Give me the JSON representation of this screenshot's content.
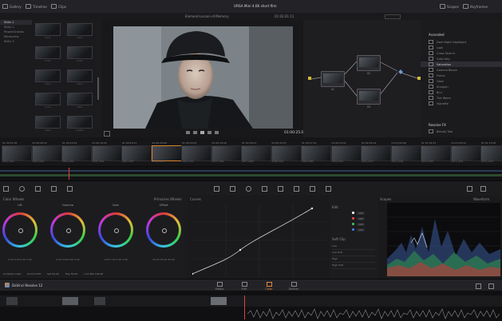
{
  "topbar": {
    "left_buttons": [
      "Gallery",
      "Timeline",
      "Clips"
    ],
    "title": "URSA Mini 4.6K short film",
    "right_buttons": [
      "Scopes",
      "Keyframes"
    ]
  },
  "viewer": {
    "clip_name": "Element-Lesson-of-Memory",
    "source_timecode": "01:02:41:11",
    "timecode": "01:00:25:09"
  },
  "gallery": {
    "albums": [
      "Stills 1",
      "Stills 2",
      "PowerGrades",
      "Memories",
      "Stills 3"
    ],
    "thumbs": [
      "1.1.1",
      "1.2.1",
      "1.3.1",
      "1.4.1",
      "1.5.1",
      "1.6.1",
      "1.7.1",
      "1.8.1",
      "1.9.1",
      "1.10.1",
      "1.11.1",
      "1.12.1",
      "1.13.1",
      "1.14.1"
    ]
  },
  "nodes": {
    "labels": [
      "01",
      "02",
      "03",
      "04"
    ]
  },
  "library": {
    "header": "Ascended",
    "items": [
      "Dark Night Hightlight",
      "Look",
      "Cross Fade In",
      "Color Key",
      "Saturation",
      "Gamma Bloom",
      "Flares",
      "Glow",
      "Sharpen",
      "Blur",
      "Tint Warm",
      "Vignette"
    ],
    "selected_index": 4,
    "footer": "Resolve FX",
    "footer_item": "Beauty Tool"
  },
  "strip": {
    "timecodes": [
      "01:00:03:18",
      "01:00:08:12",
      "01:00:12:04",
      "01:00:16:22",
      "01:00:20:11",
      "01:00:25:09",
      "01:00:30:02",
      "01:00:34:16",
      "01:00:38:21",
      "01:00:43:07",
      "01:00:47:14",
      "01:00:52:01",
      "01:00:56:19",
      "01:01:00:08",
      "01:01:04:23",
      "01:01:09:10",
      "01:01:13:05"
    ],
    "names": [
      "A004_C012",
      "A004_C015",
      "A004_C021",
      "A005_C002",
      "A005_C007",
      "A006_C003",
      "A006_C011",
      "A007_C004",
      "A007_C009",
      "A008_C001",
      "A008_C006",
      "A009_C013",
      "A009_C017",
      "A010_C002",
      "A010_C008",
      "A011_C005",
      "A011_C010"
    ],
    "selected_index": 5
  },
  "panels": {
    "wheels_title": "Color Wheels",
    "wheels_mode": "Primaries Wheels",
    "wheels": [
      {
        "name": "Lift",
        "values": "0.00  0.00  0.00  0.00"
      },
      {
        "name": "Gamma",
        "values": "0.00  0.00  0.00  0.00"
      },
      {
        "name": "Gain",
        "values": "1.00  1.00  1.00  1.00"
      },
      {
        "name": "Offset",
        "values": "25.00  25.00  25.00"
      }
    ],
    "wheels_footer": [
      "Contrast 1.000",
      "Pivot 0.435",
      "Sat 50.00",
      "Hue 50.00",
      "Lum Mix 100.00"
    ],
    "curves_title": "Curves",
    "curves_edit": "Custom",
    "edit_label": "Edit",
    "soft_clip_label": "Soft Clip",
    "soft_clip_rows": [
      "Low",
      "Low Soft",
      "High",
      "High Soft"
    ],
    "intensity_values": [
      "100",
      "100",
      "100",
      "100"
    ],
    "scope_title": "Scopes",
    "scope_mode": "Waveform"
  },
  "pagebar": {
    "app_name": "DaVinci Resolve 12",
    "pages": [
      "Media",
      "Edit",
      "Color",
      "Deliver"
    ],
    "active_index": 2
  }
}
